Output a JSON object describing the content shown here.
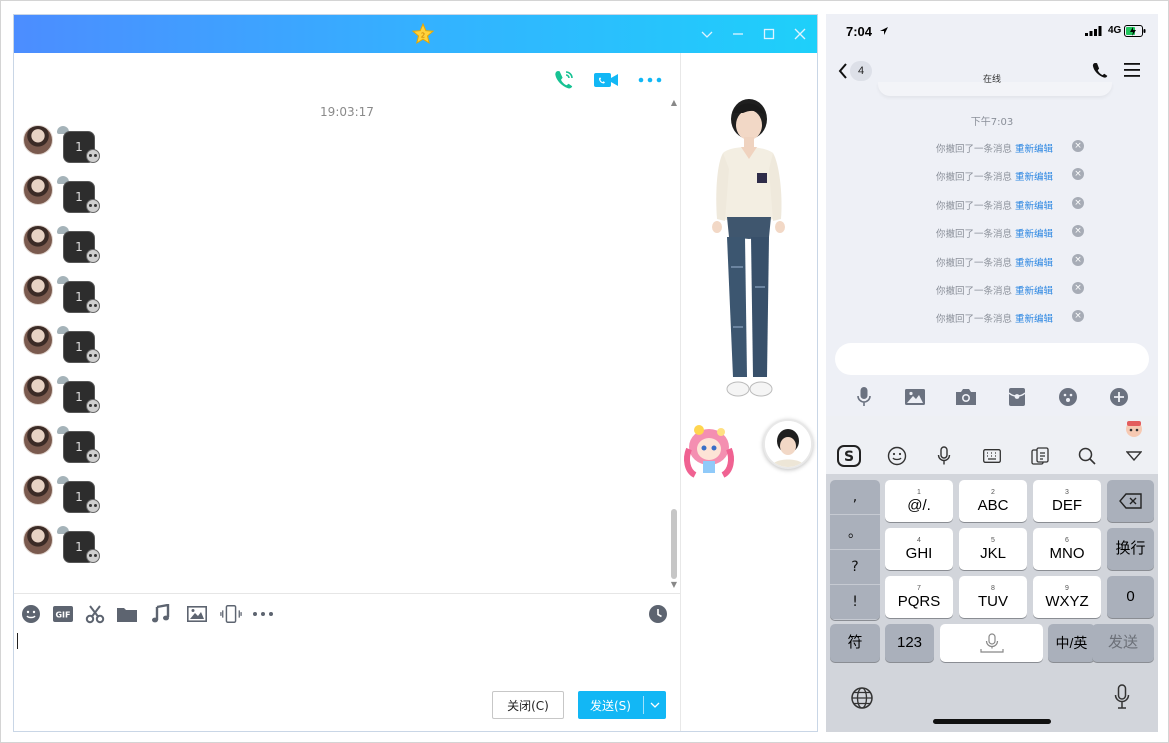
{
  "desktop": {
    "title_icon": "star-icon",
    "window_controls": [
      "chevron-down-icon",
      "minimize-icon",
      "maximize-icon",
      "close-icon"
    ],
    "toolbar_icons": [
      "voice-call-icon",
      "video-call-icon",
      "more-icon"
    ],
    "timestamp": "19:03:17",
    "messages": [
      "1",
      "1",
      "1",
      "1",
      "1",
      "1",
      "1",
      "1",
      "1"
    ],
    "input_tools": [
      "emoji-icon",
      "gif-icon",
      "scissors-icon",
      "folder-icon",
      "music-icon",
      "image-icon",
      "shake-icon",
      "more-icon",
      "history-clock-icon"
    ],
    "close_button": "关闭(C)",
    "send_button": "发送(S)"
  },
  "phone": {
    "status": {
      "time": "7:04",
      "network": "4G"
    },
    "nav": {
      "back_count": "4",
      "presence": "在线"
    },
    "time_divider": "下午7:03",
    "recalls": [
      {
        "text": "你撤回了一条消息",
        "action": "重新编辑"
      },
      {
        "text": "你撤回了一条消息",
        "action": "重新编辑"
      },
      {
        "text": "你撤回了一条消息",
        "action": "重新编辑"
      },
      {
        "text": "你撤回了一条消息",
        "action": "重新编辑"
      },
      {
        "text": "你撤回了一条消息",
        "action": "重新编辑"
      },
      {
        "text": "你撤回了一条消息",
        "action": "重新编辑"
      },
      {
        "text": "你撤回了一条消息",
        "action": "重新编辑"
      }
    ],
    "keyboard": {
      "punct": [
        ",",
        "。",
        "?",
        "!"
      ],
      "rows": [
        [
          {
            "n": "1",
            "k": "@/."
          },
          {
            "n": "2",
            "k": "ABC"
          },
          {
            "n": "3",
            "k": "DEF"
          }
        ],
        [
          {
            "n": "4",
            "k": "GHI"
          },
          {
            "n": "5",
            "k": "JKL"
          },
          {
            "n": "6",
            "k": "MNO"
          }
        ],
        [
          {
            "n": "7",
            "k": "PQRS"
          },
          {
            "n": "8",
            "k": "TUV"
          },
          {
            "n": "9",
            "k": "WXYZ"
          }
        ]
      ],
      "newline": "换行",
      "zero": "0",
      "symbol": "符",
      "numeric": "123",
      "lang": "中/英",
      "send": "发送"
    }
  }
}
